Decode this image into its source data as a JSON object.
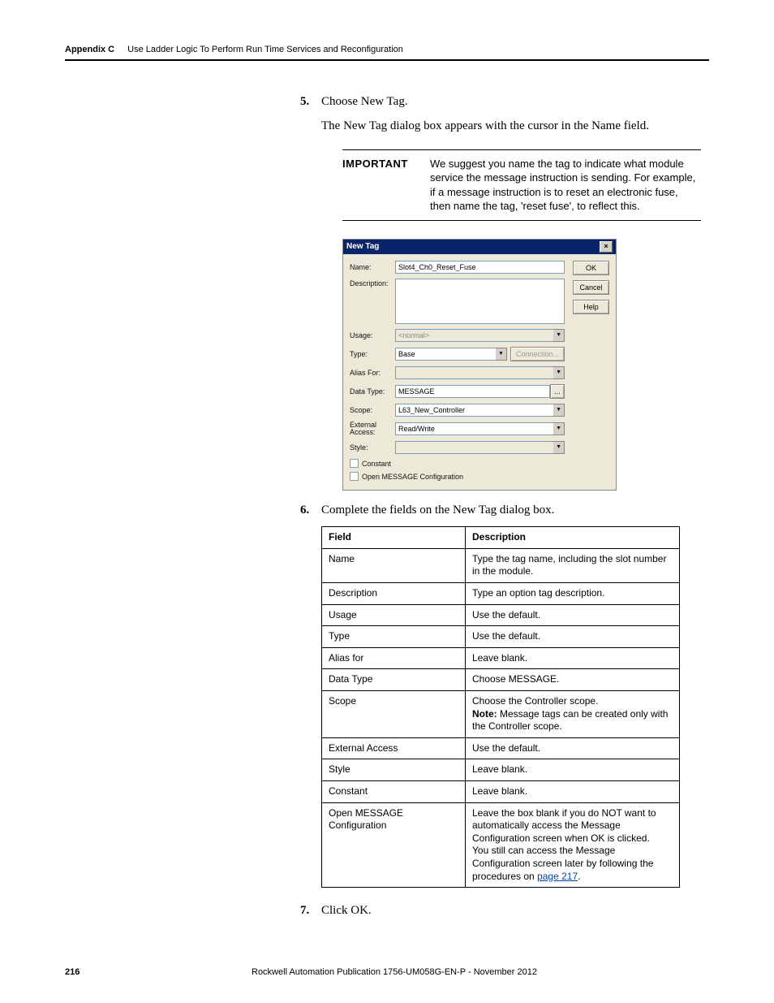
{
  "header": {
    "appendix": "Appendix C",
    "chapter": "Use Ladder Logic To Perform Run Time Services and Reconfiguration"
  },
  "step5": {
    "text": "Choose New Tag.",
    "followup": "The New Tag dialog box appears with the cursor in the Name field."
  },
  "important": {
    "label": "IMPORTANT",
    "body": "We suggest you name the tag to indicate what module service the message instruction is sending. For example, if a message instruction is to reset an electronic fuse, then name the tag, 'reset fuse', to reflect this."
  },
  "dialog": {
    "title": "New Tag",
    "labels": {
      "name": "Name:",
      "description": "Description:",
      "usage": "Usage:",
      "type": "Type:",
      "aliasFor": "Alias For:",
      "dataType": "Data Type:",
      "scope": "Scope:",
      "externalAccess": "External Access:",
      "style": "Style:"
    },
    "values": {
      "name": "Slot4_Ch0_Reset_Fuse",
      "usage": "<normal>",
      "type": "Base",
      "dataType": "MESSAGE",
      "scope": "L63_New_Controller",
      "externalAccess": "Read/Write"
    },
    "buttons": {
      "ok": "OK",
      "cancel": "Cancel",
      "help": "Help",
      "connection": "Connection...",
      "ellipsis": "..."
    },
    "checks": {
      "constant": "Constant",
      "openMsg": "Open MESSAGE Configuration"
    }
  },
  "step6": {
    "text": "Complete the fields on the New Tag dialog box."
  },
  "table": {
    "headers": {
      "field": "Field",
      "desc": "Description"
    },
    "rows": [
      {
        "f": "Name",
        "d": "Type the tag name, including the slot number in the module."
      },
      {
        "f": "Description",
        "d": "Type an option tag description."
      },
      {
        "f": "Usage",
        "d": "Use the default."
      },
      {
        "f": "Type",
        "d": "Use the default."
      },
      {
        "f": "Alias for",
        "d": "Leave blank."
      },
      {
        "f": "Data Type",
        "d": "Choose MESSAGE."
      },
      {
        "f": "Scope",
        "d": "Choose the Controller scope.\n<b>Note:</b> Message tags can be created only with the Controller scope."
      },
      {
        "f": "External Access",
        "d": "Use the default."
      },
      {
        "f": "Style",
        "d": "Leave blank."
      },
      {
        "f": "Constant",
        "d": "Leave blank."
      },
      {
        "f": "Open MESSAGE Configuration",
        "d": "Leave the box blank if you do NOT want to automatically access the Message Configuration screen when OK is clicked.\nYou still can access the Message Configuration screen later by following the procedures on <a>page 217</a>."
      }
    ]
  },
  "step7": {
    "text": "Click OK."
  },
  "footer": {
    "page": "216",
    "pub": "Rockwell Automation Publication 1756-UM058G-EN-P - November 2012"
  }
}
